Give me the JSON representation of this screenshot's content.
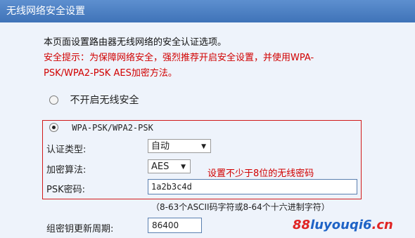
{
  "title": "无线网络安全设置",
  "intro": "本页面设置路由器无线网络的安全认证选项。",
  "warning": {
    "line1": "安全提示：为保障网络安全，强烈推荐开启安全设置，并使用WPA-",
    "line2": "PSK/WPA2-PSK AES加密方法。"
  },
  "options": {
    "disable_label": "不开启无线安全",
    "wpa_label": "WPA-PSK/WPA2-PSK"
  },
  "auth": {
    "label": "认证类型:",
    "value": "自动"
  },
  "encryption": {
    "label": "加密算法:",
    "value": "AES"
  },
  "psk": {
    "label": "PSK密码:",
    "value": "1a2b3c4d"
  },
  "annotation": "设置不少于8位的无线密码",
  "hint": "（8-63个ASCII码字符或8-64个十六进制字符）",
  "rekey": {
    "label": "组密钥更新周期:",
    "value": "86400"
  },
  "watermark": {
    "part1": "88",
    "part2": "luyouqi6",
    "part3": ".cn"
  },
  "colors": {
    "title_bar": "#4a7dc2",
    "warning": "#d10000",
    "highlight_box": "#d11a1a"
  }
}
